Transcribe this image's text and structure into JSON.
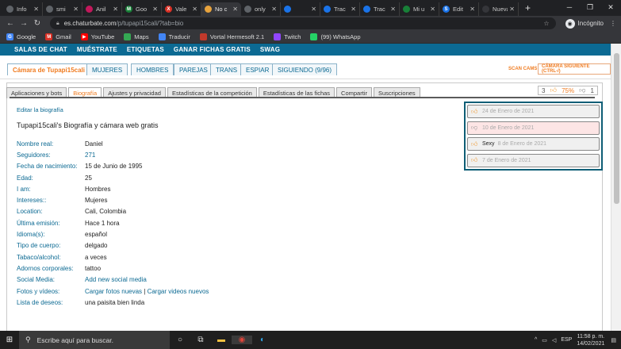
{
  "browser": {
    "tabs": [
      {
        "label": "Info",
        "fav_color": "#5f6368",
        "fav_text": ""
      },
      {
        "label": "smi",
        "fav_color": "#5f6368",
        "fav_text": ""
      },
      {
        "label": "Anil",
        "fav_color": "#c2185b",
        "fav_text": ""
      },
      {
        "label": "Goo",
        "fav_color": "#188038",
        "fav_text": "M"
      },
      {
        "label": "Vale",
        "fav_color": "#d93025",
        "fav_text": "X"
      },
      {
        "label": "No c",
        "fav_color": "#e8a33d",
        "fav_text": ""
      },
      {
        "label": "only",
        "fav_color": "#5f6368",
        "fav_text": ""
      },
      {
        "label": "",
        "fav_color": "#1a73e8",
        "fav_text": ""
      },
      {
        "label": "Trac",
        "fav_color": "#1a73e8",
        "fav_text": ""
      },
      {
        "label": "Trac",
        "fav_color": "#1a73e8",
        "fav_text": ""
      },
      {
        "label": "Mi u",
        "fav_color": "#188038",
        "fav_text": ""
      },
      {
        "label": "Edit",
        "fav_color": "#1a73e8",
        "fav_text": "S"
      },
      {
        "label": "Nueva p",
        "fav_color": "#35363a",
        "fav_text": ""
      }
    ],
    "url_host": "es.chaturbate.com",
    "url_path": "/p/tupapi15cali/?tab=bio",
    "incognito_label": "Incógnito",
    "bookmarks": [
      {
        "label": "Google",
        "icon": "google-icon",
        "color": "#4285f4",
        "text": "G"
      },
      {
        "label": "Gmail",
        "icon": "gmail-icon",
        "color": "#d93025",
        "text": "M"
      },
      {
        "label": "YouTube",
        "icon": "youtube-icon",
        "color": "#ff0000",
        "text": "▶"
      },
      {
        "label": "Maps",
        "icon": "maps-icon",
        "color": "#34a853",
        "text": ""
      },
      {
        "label": "Traducir",
        "icon": "translate-icon",
        "color": "#4285f4",
        "text": ""
      },
      {
        "label": "Vortal Hermesoft 2.1",
        "icon": "vortal-icon",
        "color": "#c0392b",
        "text": ""
      },
      {
        "label": "Twitch",
        "icon": "twitch-icon",
        "color": "#9146ff",
        "text": ""
      },
      {
        "label": "(99) WhatsApp",
        "icon": "whatsapp-icon",
        "color": "#25d366",
        "text": ""
      }
    ]
  },
  "sitenav": [
    "SALAS DE CHAT",
    "MUÉSTRATE",
    "ETIQUETAS",
    "GANAR FICHAS GRATIS",
    "SWAG"
  ],
  "roomtabs": [
    "Cámara de Tupapi15cali",
    "MUJERES",
    "HOMBRES",
    "PAREJAS",
    "TRANS",
    "ESPIAR",
    "SIGUIENDO (9/96)"
  ],
  "scan_cams": "SCAN CAMS",
  "next_cam": "CÁMARA SIGUIENTE (CTRL-/)",
  "subtabs": [
    "Aplicaciones y bots",
    "Biografía",
    "Ajustes y privacidad",
    "Estadísticas de la competición",
    "Estadísticas de las fichas",
    "Compartir",
    "Suscripciones"
  ],
  "rating": {
    "up": "3",
    "pct": "75%",
    "down": "1"
  },
  "edit_bio": "Editar la biografía",
  "bio_title": "Tupapi15cali's Biografía y cámara web gratis",
  "profile": [
    {
      "label": "Nombre real:",
      "value": "Daniel"
    },
    {
      "label": "Seguidores:",
      "value": "271"
    },
    {
      "label": "Fecha de nacimiento:",
      "value": "15 de Junio de 1995"
    },
    {
      "label": "Edad:",
      "value": "25"
    },
    {
      "label": "I am:",
      "value": "Hombres"
    },
    {
      "label": "Intereses::",
      "value": "Mujeres"
    },
    {
      "label": "Location:",
      "value": "Cali, Colombia"
    },
    {
      "label": "Última emisión:",
      "value": "Hace 1 hora"
    },
    {
      "label": "Idioma(s):",
      "value": "español"
    },
    {
      "label": "Tipo de cuerpo:",
      "value": "delgado"
    },
    {
      "label": "Tabaco/alcohol:",
      "value": "a veces"
    },
    {
      "label": "Adornos corporales:",
      "value": "tattoo"
    },
    {
      "label": "Social Media:",
      "value": "Add new social media"
    },
    {
      "label": "Fotos y vídeos:",
      "value": "Cargar fotos nuevas",
      "value2": "Cargar videos nuevos"
    },
    {
      "label": "Lista de deseos:",
      "value": "una paisita bien linda"
    }
  ],
  "reviews": [
    {
      "type": "up",
      "word": "",
      "date": "24 de Enero de 2021"
    },
    {
      "type": "down",
      "word": "",
      "date": "10 de Enero de 2021"
    },
    {
      "type": "up",
      "word": "Sexy",
      "date": "8 de Enero de 2021"
    },
    {
      "type": "up",
      "word": "",
      "date": "7 de Enero de 2021"
    }
  ],
  "taskbar": {
    "search_placeholder": "Escribe aquí para buscar.",
    "lang": "ESP",
    "time": "11:58 p. m.",
    "date": "14/02/2021"
  }
}
